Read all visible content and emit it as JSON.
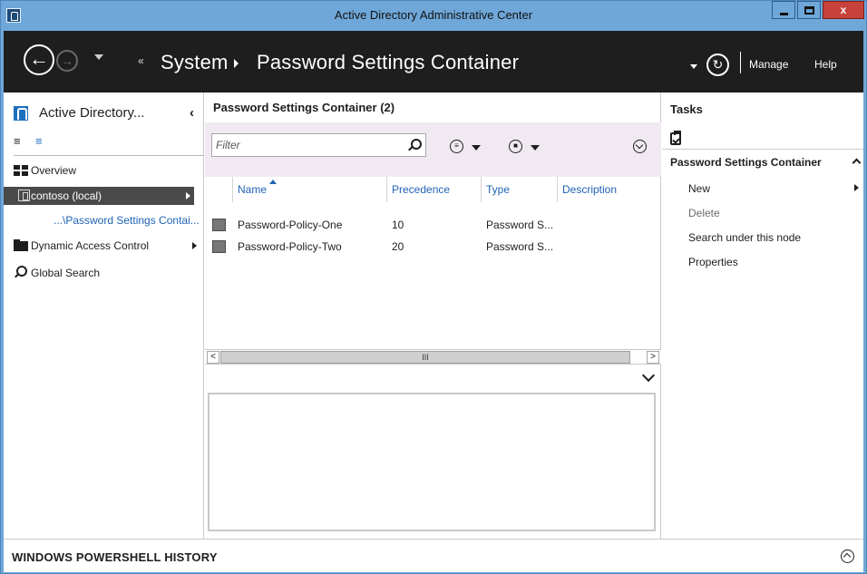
{
  "window": {
    "title": "Active Directory Administrative Center",
    "close_label": "x"
  },
  "navbar": {
    "crumbs": [
      {
        "label": "System"
      },
      {
        "label": "Password Settings Container"
      }
    ],
    "manage_label": "Manage",
    "help_label": "Help"
  },
  "left_nav": {
    "title": "Active Directory...",
    "items": [
      {
        "label": "Overview",
        "icon": "overview-icon"
      },
      {
        "label": "contoso (local)",
        "icon": "domain-icon",
        "selected": true
      },
      {
        "label": "...\\Password Settings Contai..."
      },
      {
        "label": "Dynamic Access Control",
        "icon": "folder-icon"
      },
      {
        "label": "Global Search",
        "icon": "search-icon"
      }
    ]
  },
  "center": {
    "title": "Password Settings Container  (2)",
    "filter_placeholder": "Filter",
    "columns": [
      "Name",
      "Precedence",
      "Type",
      "Description"
    ],
    "sort_column": "Name",
    "rows": [
      {
        "name": "Password-Policy-One",
        "precedence": "10",
        "type": "Password S...",
        "description": ""
      },
      {
        "name": "Password-Policy-Two",
        "precedence": "20",
        "type": "Password S...",
        "description": ""
      }
    ],
    "scroll_thumb_glyph": "III",
    "scroll_left_glyph": "<",
    "scroll_right_glyph": ">"
  },
  "tasks": {
    "title": "Tasks",
    "section": "Password Settings Container",
    "items": [
      {
        "label": "New",
        "enabled": true,
        "has_submenu": true
      },
      {
        "label": "Delete",
        "enabled": false
      },
      {
        "label": "Search under this node",
        "enabled": true
      },
      {
        "label": "Properties",
        "enabled": true
      }
    ]
  },
  "powershell": {
    "label": "WINDOWS POWERSHELL HISTORY"
  },
  "colors": {
    "title_bar": "#6fa7d9",
    "nav_bar": "#1e1e1e",
    "selected_item": "#4a4a4a",
    "link_blue": "#1f63b5",
    "toolbar_bg": "#f0e9f2"
  }
}
